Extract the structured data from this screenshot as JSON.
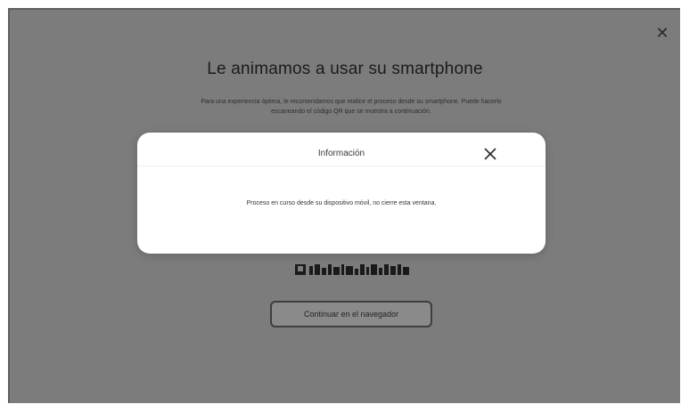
{
  "page": {
    "close_icon": "close-icon",
    "title": "Le animamos a usar su smartphone",
    "description": "Para una experiencia óptima, le recomendamos que realice el proceso desde su smartphone. Puede hacerlo escaneando el código QR que se muestra a continuación.",
    "continue_button": "Continuar en el navegador"
  },
  "dialog": {
    "title": "Información",
    "close_icon": "close-icon",
    "message": "Proceso en curso desde su dispositivo móvil, no cierre esta ventana."
  },
  "colors": {
    "overlay_gray": "#7c7c7c",
    "dialog_background": "#ffffff"
  }
}
